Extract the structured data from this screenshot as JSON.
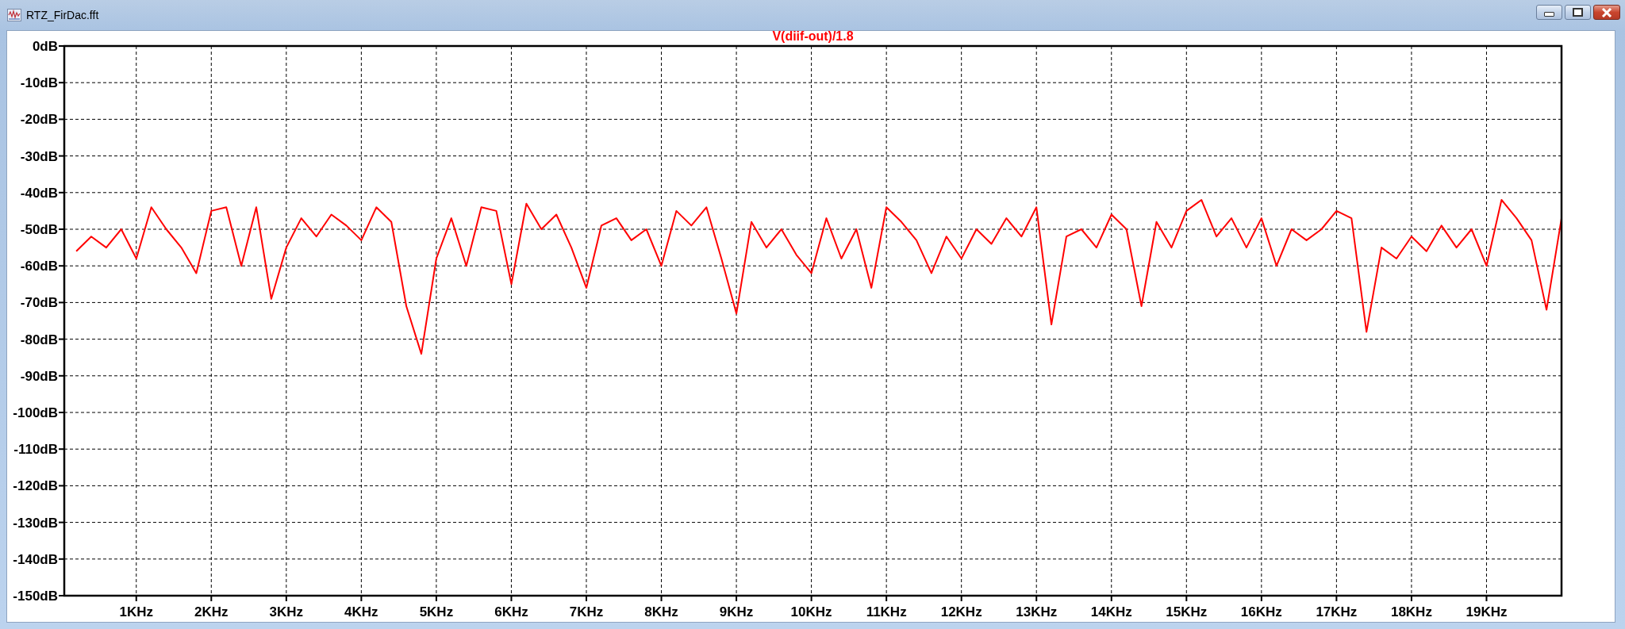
{
  "window": {
    "title": "RTZ_FirDac.fft"
  },
  "plot": {
    "chart_data": {
      "type": "line",
      "grid": true,
      "xlim": [
        0.04,
        20
      ],
      "ylim": [
        -150,
        0
      ],
      "xticks": [
        {
          "value": 1,
          "label": "1KHz"
        },
        {
          "value": 2,
          "label": "2KHz"
        },
        {
          "value": 3,
          "label": "3KHz"
        },
        {
          "value": 4,
          "label": "4KHz"
        },
        {
          "value": 5,
          "label": "5KHz"
        },
        {
          "value": 6,
          "label": "6KHz"
        },
        {
          "value": 7,
          "label": "7KHz"
        },
        {
          "value": 8,
          "label": "8KHz"
        },
        {
          "value": 9,
          "label": "9KHz"
        },
        {
          "value": 10,
          "label": "10KHz"
        },
        {
          "value": 11,
          "label": "11KHz"
        },
        {
          "value": 12,
          "label": "12KHz"
        },
        {
          "value": 13,
          "label": "13KHz"
        },
        {
          "value": 14,
          "label": "14KHz"
        },
        {
          "value": 15,
          "label": "15KHz"
        },
        {
          "value": 16,
          "label": "16KHz"
        },
        {
          "value": 17,
          "label": "17KHz"
        },
        {
          "value": 18,
          "label": "18KHz"
        },
        {
          "value": 19,
          "label": "19KHz"
        }
      ],
      "yticks": [
        {
          "value": 0,
          "label": "0dB"
        },
        {
          "value": -10,
          "label": "-10dB"
        },
        {
          "value": -20,
          "label": "-20dB"
        },
        {
          "value": -30,
          "label": "-30dB"
        },
        {
          "value": -40,
          "label": "-40dB"
        },
        {
          "value": -50,
          "label": "-50dB"
        },
        {
          "value": -60,
          "label": "-60dB"
        },
        {
          "value": -70,
          "label": "-70dB"
        },
        {
          "value": -80,
          "label": "-80dB"
        },
        {
          "value": -90,
          "label": "-90dB"
        },
        {
          "value": -100,
          "label": "-100dB"
        },
        {
          "value": -110,
          "label": "-110dB"
        },
        {
          "value": -120,
          "label": "-120dB"
        },
        {
          "value": -130,
          "label": "-130dB"
        },
        {
          "value": -140,
          "label": "-140dB"
        },
        {
          "value": -150,
          "label": "-150dB"
        }
      ],
      "x": [
        0.2,
        0.4,
        0.6,
        0.8,
        1.0,
        1.2,
        1.4,
        1.6,
        1.8,
        2.0,
        2.2,
        2.4,
        2.6,
        2.8,
        3.0,
        3.2,
        3.4,
        3.6,
        3.8,
        4.0,
        4.2,
        4.4,
        4.6,
        4.8,
        5.0,
        5.2,
        5.4,
        5.6,
        5.8,
        6.0,
        6.2,
        6.4,
        6.6,
        6.8,
        7.0,
        7.2,
        7.4,
        7.6,
        7.8,
        8.0,
        8.2,
        8.4,
        8.6,
        8.8,
        9.0,
        9.2,
        9.4,
        9.6,
        9.8,
        10.0,
        10.2,
        10.4,
        10.6,
        10.8,
        11.0,
        11.2,
        11.4,
        11.6,
        11.8,
        12.0,
        12.2,
        12.4,
        12.6,
        12.8,
        13.0,
        13.2,
        13.4,
        13.6,
        13.8,
        14.0,
        14.2,
        14.4,
        14.6,
        14.8,
        15.0,
        15.2,
        15.4,
        15.6,
        15.8,
        16.0,
        16.2,
        16.4,
        16.6,
        16.8,
        17.0,
        17.2,
        17.4,
        17.6,
        17.8,
        18.0,
        18.2,
        18.4,
        18.6,
        18.8,
        19.0,
        19.2,
        19.4,
        19.6,
        19.8,
        20.0
      ],
      "series": [
        {
          "name": "V(diif-out)/1.8",
          "color": "#ff0000",
          "values": [
            -56,
            -52,
            -55,
            -50,
            -58,
            -44,
            -50,
            -55,
            -62,
            -45,
            -44,
            -60,
            -44,
            -69,
            -55,
            -47,
            -52,
            -46,
            -49,
            -53,
            -44,
            -48,
            -71,
            -84,
            -58,
            -47,
            -60,
            -44,
            -45,
            -65,
            -43,
            -50,
            -46,
            -55,
            -66,
            -49,
            -47,
            -53,
            -50,
            -60,
            -45,
            -49,
            -44,
            -58,
            -73,
            -48,
            -55,
            -50,
            -57,
            -62,
            -47,
            -58,
            -50,
            -66,
            -44,
            -48,
            -53,
            -62,
            -52,
            -58,
            -50,
            -54,
            -47,
            -52,
            -44,
            -76,
            -52,
            -50,
            -55,
            -46,
            -50,
            -71,
            -48,
            -55,
            -45,
            -42,
            -52,
            -47,
            -55,
            -47,
            -60,
            -50,
            -53,
            -50,
            -45,
            -47,
            -78,
            -55,
            -58,
            -52,
            -56,
            -49,
            -55,
            -50,
            -60,
            -42,
            -47,
            -53,
            -72,
            -47
          ]
        }
      ]
    }
  }
}
